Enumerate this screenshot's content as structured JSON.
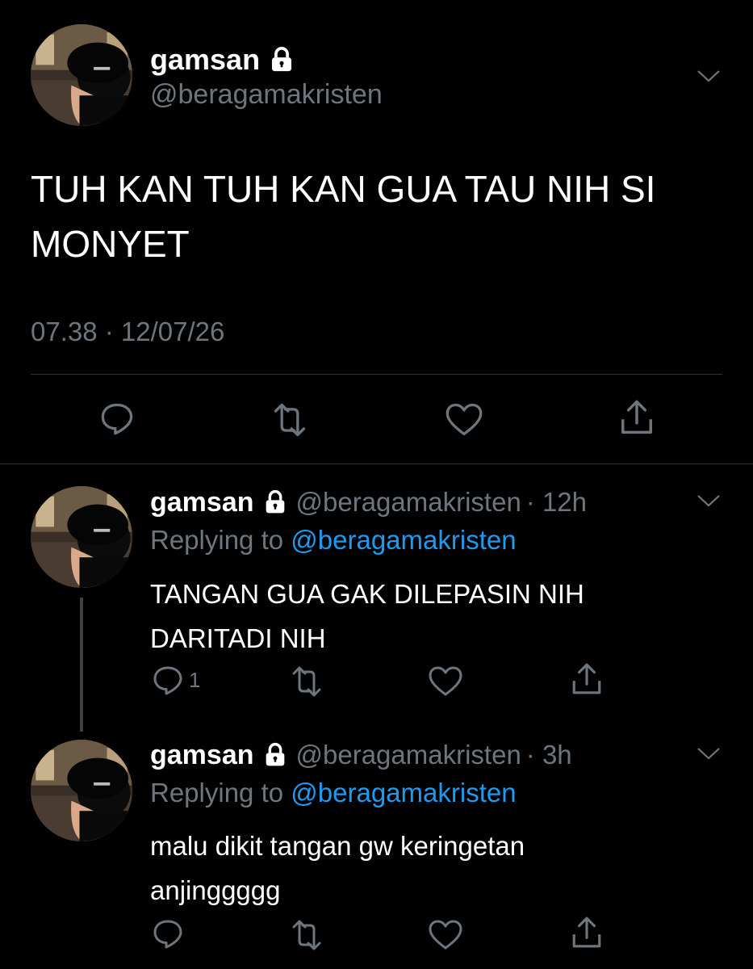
{
  "main_tweet": {
    "name": "gamsan",
    "handle": "@beragamakristen",
    "text": "TUH KAN TUH KAN GUA TAU NIH SI MONYET",
    "timestamp": "07.38 · 12/07/26"
  },
  "replies": [
    {
      "name": "gamsan",
      "handle": "@beragamakristen",
      "time": "· 12h",
      "replying_label": "Replying to",
      "replying_to": "@beragamakristen",
      "text": "TANGAN GUA GAK DILEPASIN NIH DARITADI NIH",
      "reply_count": "1"
    },
    {
      "name": "gamsan",
      "handle": "@beragamakristen",
      "time": "· 3h",
      "replying_label": "Replying to",
      "replying_to": "@beragamakristen",
      "text": "malu dikit tangan gw keringetan anjinggggg",
      "reply_count": ""
    }
  ],
  "icons": [
    "lock-icon",
    "chevron-down-icon",
    "reply-icon",
    "retweet-icon",
    "like-icon",
    "share-icon"
  ],
  "colors": {
    "background": "#000000",
    "muted": "#6e767d",
    "link": "#1d9bf0",
    "divider": "#2f3336"
  }
}
